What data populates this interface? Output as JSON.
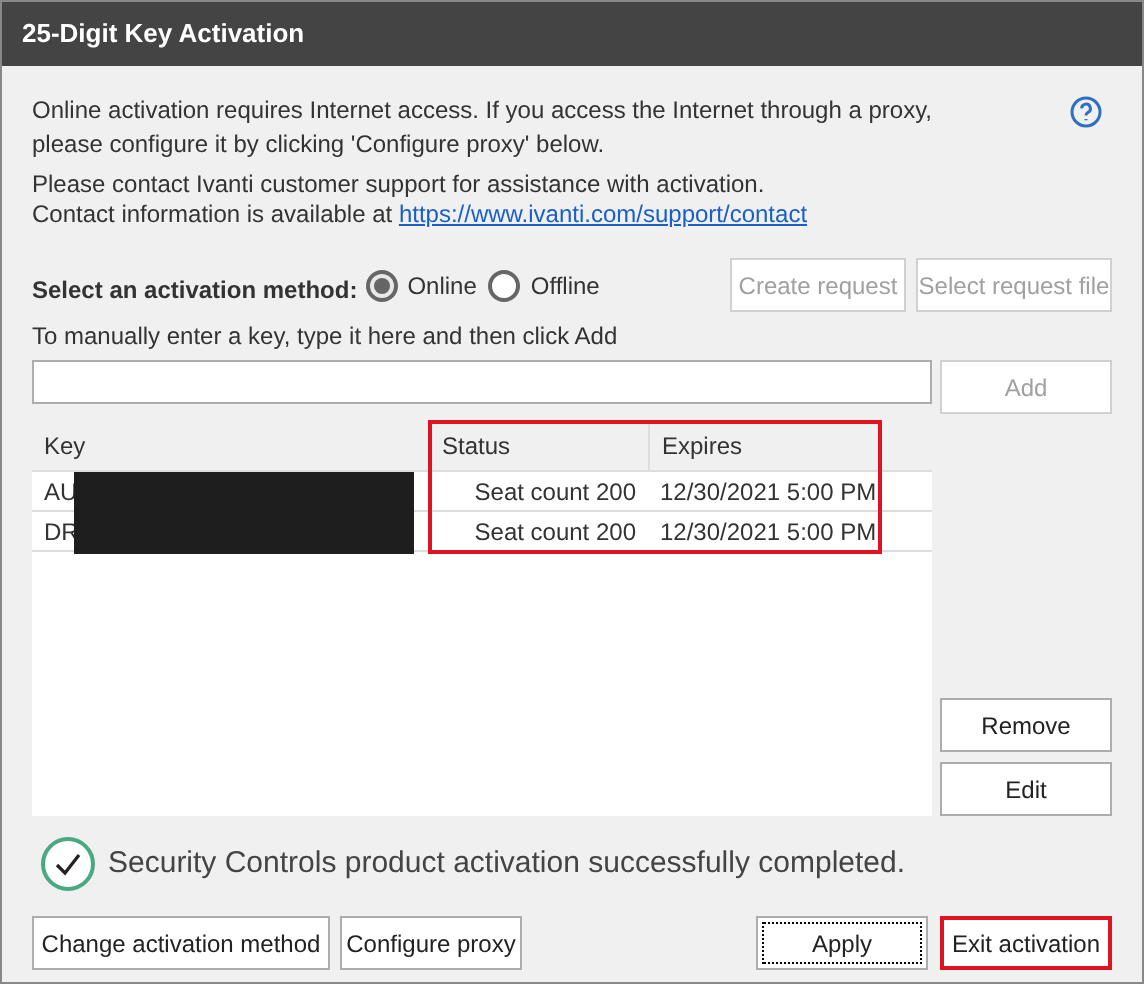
{
  "window": {
    "title": "25-Digit Key Activation"
  },
  "intro": [
    "Online activation requires Internet access. If you access the Internet through a proxy, please configure it by clicking 'Configure proxy' below."
  ],
  "contact": {
    "line1": "Please contact Ivanti customer support for assistance with activation.",
    "line2": "Contact information is available at",
    "link": "https://www.ivanti.com/support/contact"
  },
  "method": {
    "label": "Select an activation method:",
    "options": [
      {
        "label": "Online",
        "selected": true
      },
      {
        "label": "Offline",
        "selected": false
      }
    ],
    "buttons": [
      {
        "label": "Create request",
        "disabled": true
      },
      {
        "label": "Select request file",
        "disabled": true
      }
    ]
  },
  "manual": {
    "label": "To manually enter a key, type it here and then click Add",
    "add": {
      "label": "Add",
      "disabled": true
    }
  },
  "table": {
    "columns": [
      {
        "label": "Key",
        "highlighted": false
      },
      {
        "label": "Status",
        "highlighted": true
      },
      {
        "label": "Expires",
        "highlighted": true
      }
    ],
    "rows": [
      {
        "key": "AU",
        "redacted": true,
        "status": "Seat count 200",
        "expires": "12/30/2021 5:00 PM"
      },
      {
        "key": "DR",
        "redacted": true,
        "status": "Seat count 200",
        "expires": "12/30/2021 5:00 PM"
      }
    ]
  },
  "side_buttons": [
    {
      "label": "Remove"
    },
    {
      "label": "Edit"
    }
  ],
  "status_message": {
    "text": "Security Controls product activation successfully completed.",
    "success": true
  },
  "footer_buttons": [
    {
      "label": "Change activation method",
      "focused": false,
      "highlighted": false
    },
    {
      "label": "Configure proxy",
      "focused": false,
      "highlighted": false
    }
  ],
  "action_buttons": [
    {
      "label": "Apply",
      "focused": true,
      "highlighted": false
    },
    {
      "label": "Exit activation",
      "focused": false,
      "highlighted": true
    }
  ]
}
